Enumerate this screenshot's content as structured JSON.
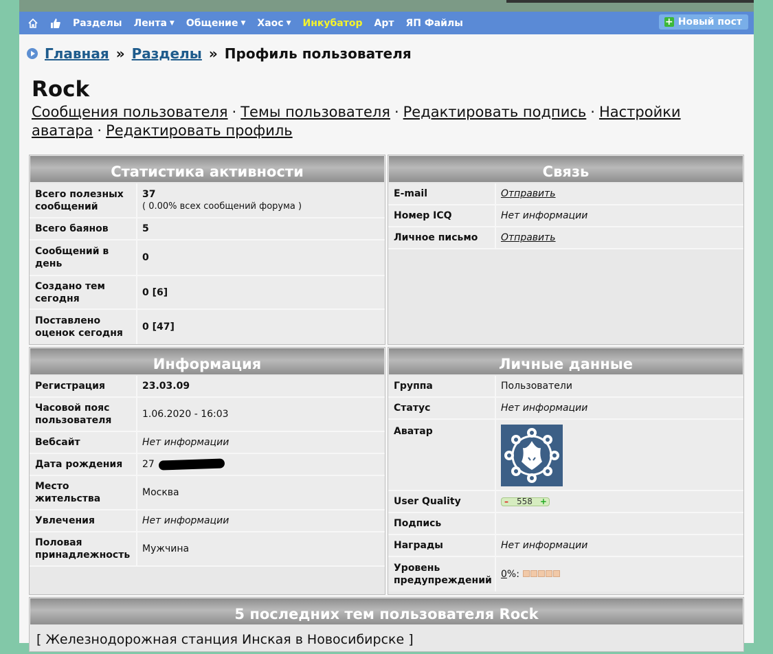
{
  "nav": {
    "items": [
      {
        "label": "Разделы",
        "dropdown": false
      },
      {
        "label": "Лента",
        "dropdown": true
      },
      {
        "label": "Общение",
        "dropdown": true
      },
      {
        "label": "Хаос",
        "dropdown": true
      },
      {
        "label": "Инкубатор",
        "dropdown": false,
        "highlight": "#f5f32a"
      },
      {
        "label": "Арт",
        "dropdown": false
      },
      {
        "label": "ЯП Файлы",
        "dropdown": false
      }
    ],
    "new_post": "Новый пост"
  },
  "breadcrumb": {
    "home": "Главная",
    "sections": "Разделы",
    "sep": "»",
    "current": "Профиль пользователя"
  },
  "user": {
    "name": "Rock",
    "links": {
      "posts": "Сообщения пользователя",
      "topics": "Темы пользователя",
      "edit_signature": "Редактировать подпись",
      "avatar_settings": "Настройки аватара",
      "edit_profile": "Редактировать профиль"
    }
  },
  "activity": {
    "title": "Статистика активности",
    "rows": [
      {
        "label": "Всего полезных сообщений",
        "value": "37",
        "sub": "( 0.00% всех сообщений форума )"
      },
      {
        "label": "Всего баянов",
        "value": "5"
      },
      {
        "label": "Сообщений в день",
        "value": "0"
      },
      {
        "label": "Создано тем сегодня",
        "value": "0 [6]"
      },
      {
        "label": "Поставлено оценок сегодня",
        "value": "0 [47]"
      }
    ]
  },
  "contact": {
    "title": "Связь",
    "rows": [
      {
        "label": "E-mail",
        "value": "Отправить",
        "link": true
      },
      {
        "label": "Номер ICQ",
        "value": "Нет информации",
        "link": false
      },
      {
        "label": "Личное письмо",
        "value": "Отправить",
        "link": true
      }
    ]
  },
  "info": {
    "title": "Информация",
    "rows": [
      {
        "label": "Регистрация",
        "value": "23.03.09",
        "style": "b"
      },
      {
        "label": "Часовой пояс пользователя",
        "value": "1.06.2020 - 16:03",
        "style": ""
      },
      {
        "label": "Вебсайт",
        "value": "Нет информации",
        "style": "i"
      },
      {
        "label": "Дата рождения",
        "value": "27",
        "style": "",
        "redacted": true
      },
      {
        "label": "Место жительства",
        "value": "Москва",
        "style": ""
      },
      {
        "label": "Увлечения",
        "value": "Нет информации",
        "style": "i"
      },
      {
        "label": "Половая принадлежность",
        "value": "Мужчина",
        "style": ""
      }
    ]
  },
  "personal": {
    "title": "Личные данные",
    "group_label": "Группа",
    "group_value": "Пользователи",
    "status_label": "Статус",
    "status_value": "Нет информации",
    "avatar_label": "Аватар",
    "uq_label": "User Quality",
    "uq_value": "558",
    "uq_minus": "–",
    "uq_plus": "+",
    "signature_label": "Подпись",
    "awards_label": "Награды",
    "awards_value": "Нет информации",
    "warn_label": "Уровень предупреждений",
    "warn_value": "0",
    "warn_suffix": "%:"
  },
  "last_topics": {
    "title": "5 последних тем пользователя Rock",
    "items": [
      "[ Железнодорожная станция Инская в Новосибирске ]"
    ]
  }
}
